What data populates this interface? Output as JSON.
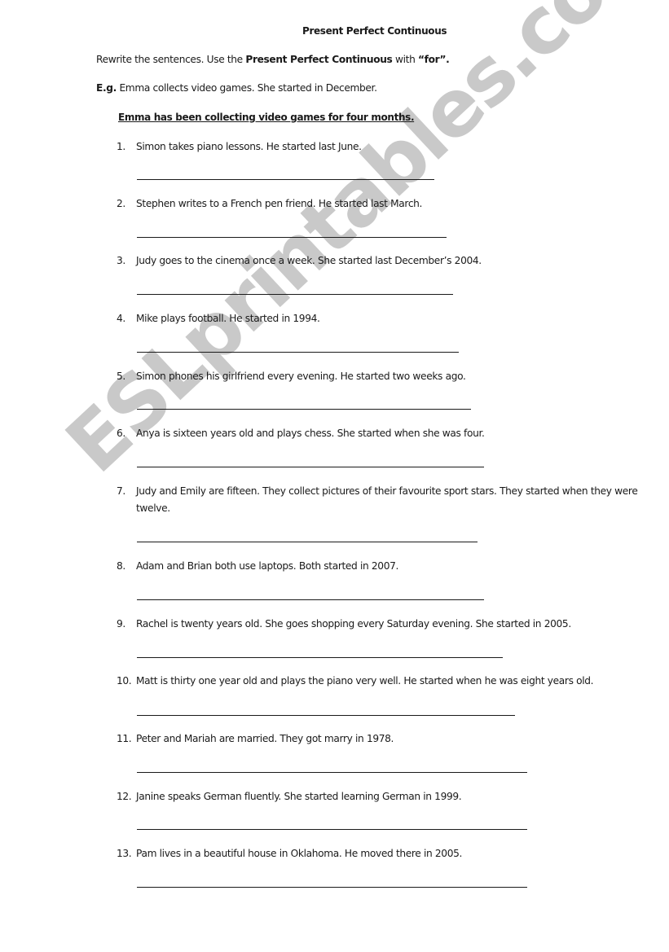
{
  "watermark": "ESLprintables.com",
  "title": "Present Perfect Continuous",
  "instruction": {
    "prefix": "Rewrite the sentences. Use the ",
    "bold1": "Present Perfect Continuous",
    "middle": " with ",
    "bold2": "“for”."
  },
  "example": {
    "label": "E.g.",
    "text": " Emma collects video games. She started in December.",
    "answer": "Emma has been collecting video games for four months."
  },
  "items": [
    {
      "num": "1.",
      "text": "Simon takes piano lessons. He started last June."
    },
    {
      "num": "2.",
      "text": "Stephen writes to a French pen friend. He started last March."
    },
    {
      "num": "3.",
      "text": "Judy goes to the cinema once a week. She started last December’s 2004."
    },
    {
      "num": "4.",
      "text": "Mike plays football. He started in 1994."
    },
    {
      "num": "5.",
      "text": "Simon phones his girlfriend every evening. He started two weeks ago."
    },
    {
      "num": "6.",
      "text": "Anya is sixteen years old and plays chess. She started when she was four."
    },
    {
      "num": "7.",
      "text": "Judy and Emily are fifteen. They collect pictures of their favourite sport stars. They started when they were twelve."
    },
    {
      "num": "8.",
      "text": "Adam and Brian both use laptops. Both started in 2007."
    },
    {
      "num": "9.",
      "text": "Rachel is twenty years old. She goes shopping every Saturday evening. She started in 2005."
    },
    {
      "num": "10.",
      "text": "Matt is thirty one year old and plays the piano very well. He started when he was eight years old."
    },
    {
      "num": "11.",
      "text": " Peter and Mariah are married. They got marry in 1978."
    },
    {
      "num": "12.",
      "text": "Janine speaks German fluently. She started learning German in 1999."
    },
    {
      "num": "13.",
      "text": "Pam lives in a beautiful house in Oklahoma. He moved there in 2005."
    }
  ]
}
